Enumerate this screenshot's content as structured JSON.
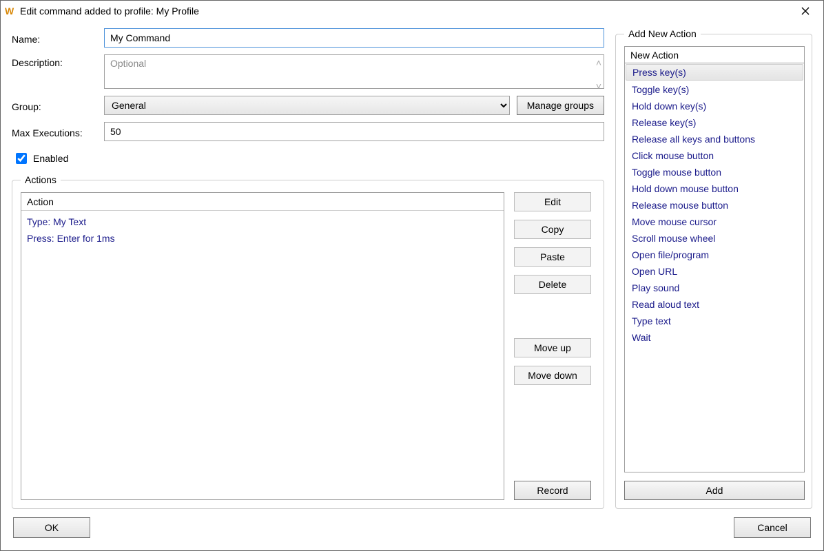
{
  "window": {
    "title": "Edit command added to profile: My Profile"
  },
  "form": {
    "nameLabel": "Name:",
    "nameValue": "My Command",
    "descLabel": "Description:",
    "descPlaceholder": "Optional",
    "descValue": "",
    "groupLabel": "Group:",
    "groupValue": "General",
    "manageGroups": "Manage groups",
    "maxExecLabel": "Max Executions:",
    "maxExecValue": "50",
    "enabledLabel": "Enabled",
    "enabledChecked": true
  },
  "actions": {
    "legend": "Actions",
    "columnHeader": "Action",
    "items": [
      "Type: My Text",
      "Press: Enter for 1ms"
    ],
    "buttons": {
      "edit": "Edit",
      "copy": "Copy",
      "paste": "Paste",
      "delete": "Delete",
      "moveUp": "Move up",
      "moveDown": "Move down",
      "record": "Record"
    }
  },
  "addNew": {
    "legend": "Add New Action",
    "header": "New Action",
    "items": [
      "Press key(s)",
      "Toggle key(s)",
      "Hold down key(s)",
      "Release key(s)",
      "Release all keys and buttons",
      "Click mouse button",
      "Toggle mouse button",
      "Hold down mouse button",
      "Release mouse button",
      "Move mouse cursor",
      "Scroll mouse wheel",
      "Open file/program",
      "Open URL",
      "Play sound",
      "Read aloud text",
      "Type text",
      "Wait"
    ],
    "selectedIndex": 0,
    "addButton": "Add"
  },
  "footer": {
    "ok": "OK",
    "cancel": "Cancel"
  }
}
